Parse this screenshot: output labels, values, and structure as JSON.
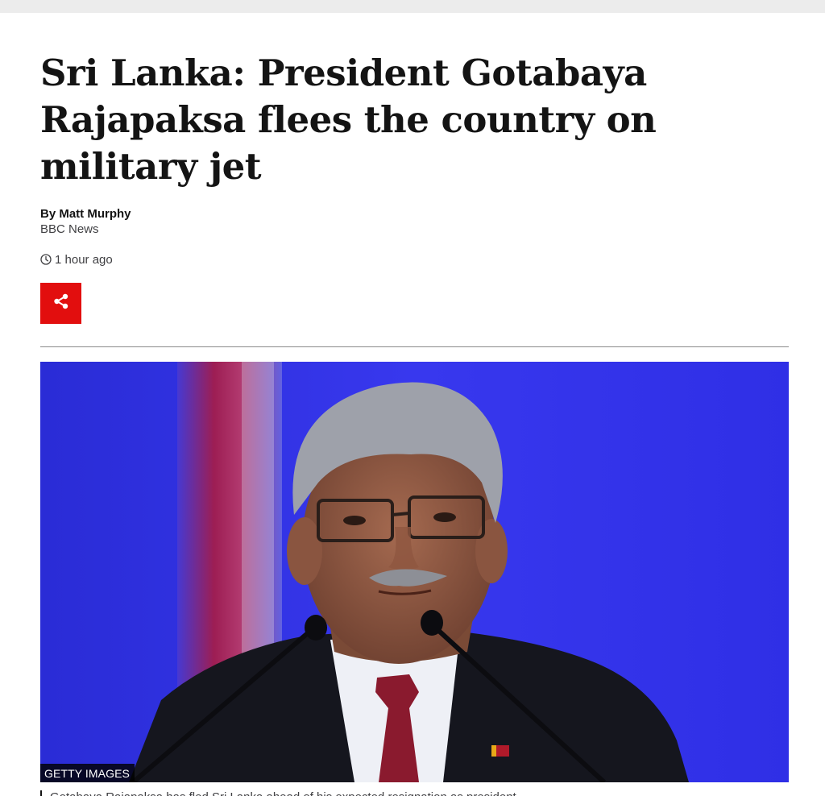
{
  "article": {
    "headline": "Sri Lanka: President Gotabaya Rajapaksa flees the country on military jet",
    "author": "By Matt Murphy",
    "organization": "BBC News",
    "timestamp": "1 hour ago",
    "share_icon": "share-icon",
    "clock_icon": "clock-icon"
  },
  "image": {
    "credit": "GETTY IMAGES",
    "caption": "Gotabaya Rajapaksa has fled Sri Lanka ahead of his expected resignation as president"
  },
  "colors": {
    "share_button": "#e20e0e",
    "photo_background": "#2d2ee8"
  }
}
